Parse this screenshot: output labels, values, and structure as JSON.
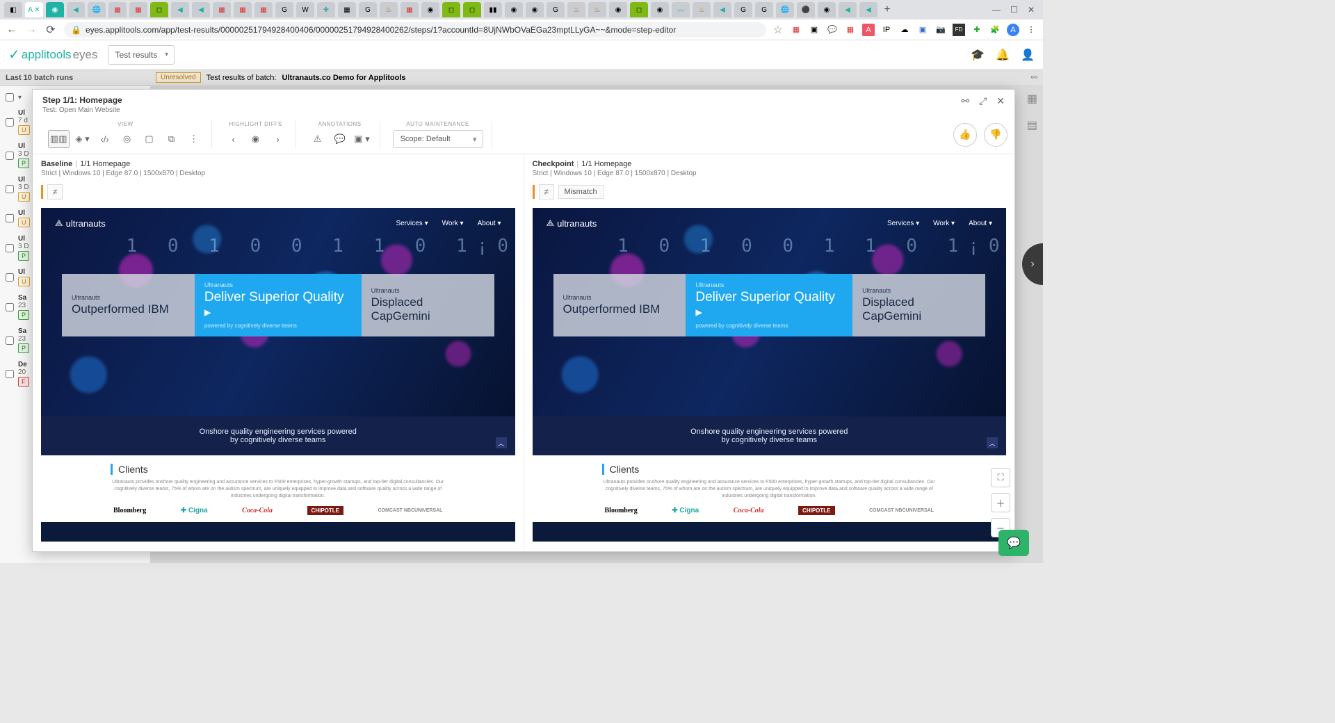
{
  "browser": {
    "url": "eyes.applitools.com/app/test-results/00000251794928400406/00000251794928400262/steps/1?accountId=8UjNWbOVaEGa23mptLLyGA~~&mode=step-editor",
    "window_controls": {
      "min": "—",
      "max": "☐",
      "close": "✕"
    }
  },
  "app_header": {
    "brand1": "applitools",
    "brand2": "eyes",
    "dropdown": "Test results"
  },
  "subheader": "Last 10 batch runs",
  "results_bar": {
    "status": "Unresolved",
    "label": "Test results of batch:",
    "name": "Ultranauts.co Demo for Applitools"
  },
  "sidebar_items": [
    {
      "title": "Ul",
      "sub": "7 d",
      "badge": "U"
    },
    {
      "title": "Ul",
      "sub": "3 D",
      "badge": "P"
    },
    {
      "title": "Ul",
      "sub": "3 D",
      "badge": "U"
    },
    {
      "title": "Ul",
      "sub": "",
      "badge": "U"
    },
    {
      "title": "Ul",
      "sub": "3 D",
      "badge": "P"
    },
    {
      "title": "Ul",
      "sub": "",
      "badge": "U"
    },
    {
      "title": "Sa",
      "sub": "23",
      "badge": "P"
    },
    {
      "title": "Sa",
      "sub": "23",
      "badge": "P"
    },
    {
      "title": "De",
      "sub": "20",
      "badge": "F"
    }
  ],
  "modal": {
    "title": "Step 1/1: Homepage",
    "subtitle": "Test: Open Main Website",
    "toolbar_groups": {
      "view": "VIEW",
      "highlight": "HIGHLIGHT DIFFS",
      "annotations": "ANNOTATIONS",
      "auto": "AUTO MAINTENANCE"
    },
    "scope": "Scope: Default"
  },
  "baseline": {
    "label": "Baseline",
    "page": "1/1 Homepage",
    "meta": "Strict  |  Windows 10  |  Edge 87.0  |  1500x870  |  Desktop",
    "diff_icon": "≠"
  },
  "checkpoint": {
    "label": "Checkpoint",
    "page": "1/1 Homepage",
    "meta": "Strict  |  Windows 10  |  Edge 87.0  |  1500x870  |  Desktop",
    "diff_icon": "≠",
    "diff_text": "Mismatch"
  },
  "site": {
    "logo": "ultranauts",
    "menu": [
      "Services ▾",
      "Work ▾",
      "About ▾"
    ],
    "cards": {
      "left_small": "Ultranauts",
      "left_big": "Outperformed IBM",
      "mid_small": "Ultranauts",
      "mid_big": "Deliver Superior Quality ▸",
      "mid_tag": "powered by cognitively diverse teams",
      "right_small": "Ultranauts",
      "right_big": "Displaced CapGemini"
    },
    "band1": "Onshore quality engineering services powered",
    "band2": "by cognitively diverse teams",
    "clients_title": "Clients",
    "clients_desc": "Ultranauts provides onshore quality engineering and assurance services to F500 enterprises, hyper-growth startups, and top-tier digital consultancies. Our cognitively diverse teams, 75% of whom are on the autism spectrum, are uniquely equipped to improve data and software quality across a wide range of industries undergoing digital transformation.",
    "logos": {
      "bloomberg": "Bloomberg",
      "cigna": "✚ Cigna",
      "coke": "Coca-Cola",
      "chipotle": "CHIPOTLE",
      "comcast": "COMCAST\nNBCUNIVERSAL"
    }
  }
}
